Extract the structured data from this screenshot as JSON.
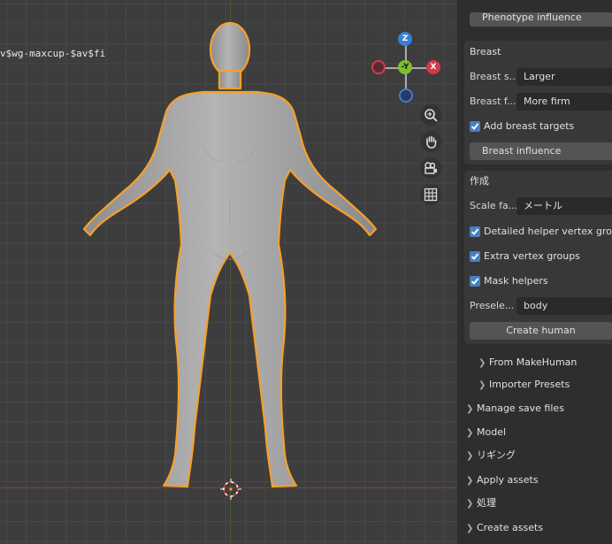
{
  "viewport": {
    "object_name": "v$wg-maxcup-$av$fi",
    "gizmo": {
      "z": "Z",
      "y": "-Y",
      "x": "X"
    }
  },
  "panel": {
    "top_button": "Phenotype influence",
    "breast_section": {
      "title": "Breast",
      "size_label": "Breast s...",
      "size_value": "Larger",
      "firmness_label": "Breast f...",
      "firmness_value": "More firm",
      "add_targets_label": "Add breast targets",
      "influence_button": "Breast influence"
    },
    "create_section": {
      "title": "作成",
      "scale_label": "Scale fa...",
      "scale_value": "メートル",
      "detailed_helper_label": "Detailed helper vertex groups",
      "extra_vertex_label": "Extra vertex groups",
      "mask_helpers_label": "Mask helpers",
      "preselect_label": "Presele...",
      "preselect_value": "body",
      "create_button": "Create human"
    },
    "subpanels": [
      "From MakeHuman",
      "Importer Presets"
    ],
    "collapsed_sections": [
      "Manage save files",
      "Model",
      "リギング",
      "Apply assets",
      "処理",
      "Create assets"
    ]
  },
  "colors": {
    "x_axis": "#d23a4c",
    "y_axis": "#7fbf2e",
    "z_axis": "#3a7fd2",
    "selection_outline": "#f5a02d",
    "checkbox": "#4a7fc0"
  }
}
